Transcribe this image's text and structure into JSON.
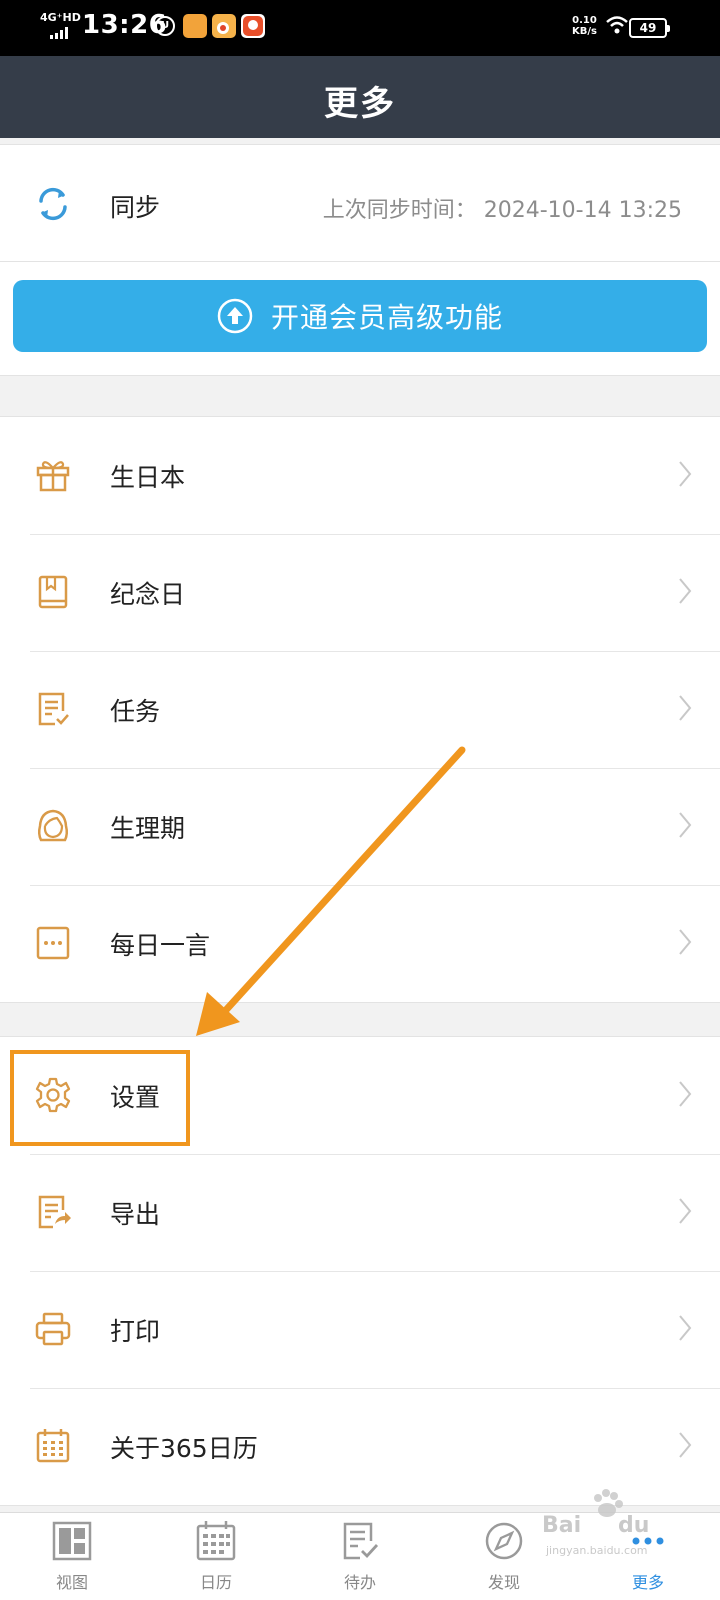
{
  "status_bar": {
    "network": "4G⁺HD",
    "time": "13:26",
    "speed_value": "0.10",
    "speed_unit": "KB/s",
    "battery": "49"
  },
  "header": {
    "title": "更多"
  },
  "sync": {
    "label": "同步",
    "last_sync": "上次同步时间： 2024-10-14 13:25"
  },
  "vip": {
    "label": "开通会员高级功能"
  },
  "group1": [
    {
      "label": "生日本",
      "icon": "gift-icon"
    },
    {
      "label": "纪念日",
      "icon": "book-icon"
    },
    {
      "label": "任务",
      "icon": "task-icon"
    },
    {
      "label": "生理期",
      "icon": "woman-icon"
    },
    {
      "label": "每日一言",
      "icon": "quote-icon"
    }
  ],
  "group2": [
    {
      "label": "设置",
      "icon": "gear-icon"
    },
    {
      "label": "导出",
      "icon": "export-icon"
    },
    {
      "label": "打印",
      "icon": "printer-icon"
    },
    {
      "label": "关于365日历",
      "icon": "calendar-icon"
    }
  ],
  "bottom_nav": [
    {
      "label": "视图",
      "icon": "view-icon",
      "active": false
    },
    {
      "label": "日历",
      "icon": "calendar-nav-icon",
      "active": false
    },
    {
      "label": "待办",
      "icon": "todo-icon",
      "active": false
    },
    {
      "label": "发现",
      "icon": "compass-icon",
      "active": false
    },
    {
      "label": "更多",
      "icon": "more-icon",
      "active": true
    }
  ],
  "colors": {
    "header_bg": "#353d49",
    "vip_button": "#34aee8",
    "icon_orange": "#d99a48",
    "annotation": "#f0961e",
    "active_nav": "#2f8fe0"
  }
}
